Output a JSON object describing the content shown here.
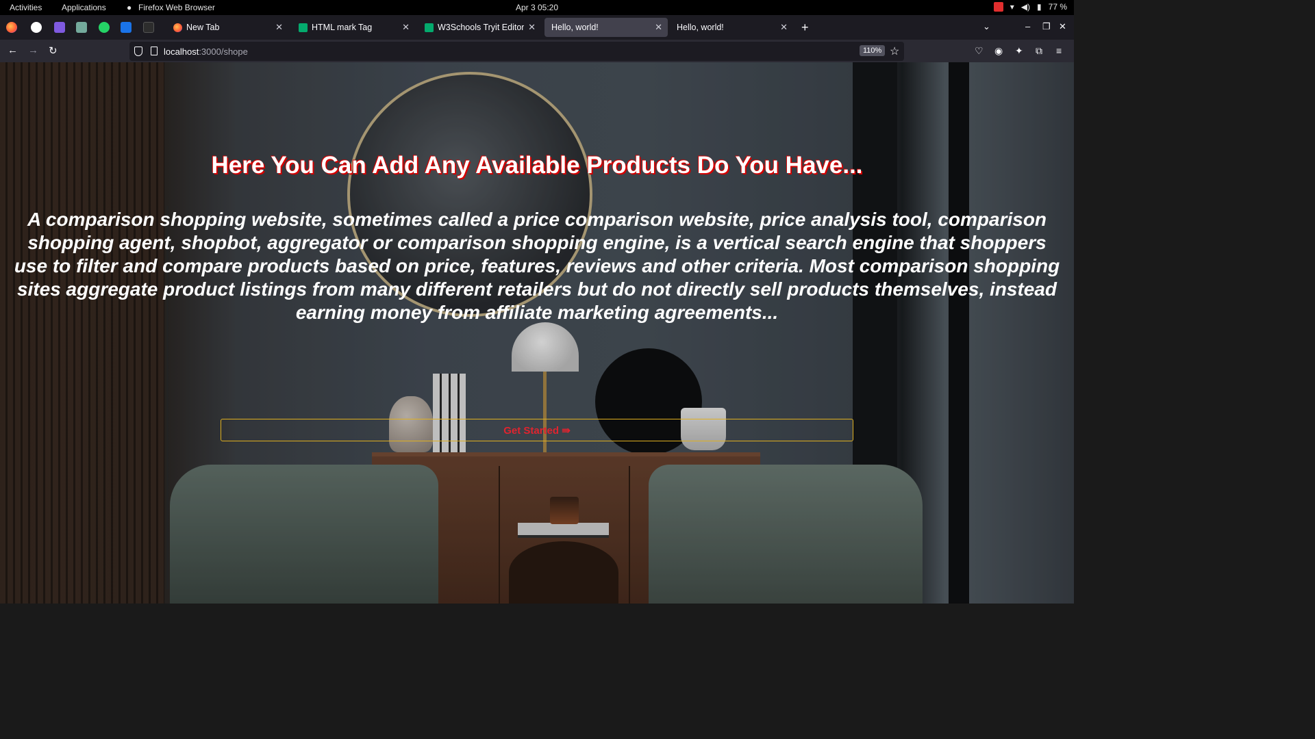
{
  "system_bar": {
    "activities": "Activities",
    "applications": "Applications",
    "app_name": "Firefox Web Browser",
    "clock": "Apr 3  05:20",
    "battery": "77 %"
  },
  "tabs": [
    {
      "label": "New Tab",
      "icon": "firefox-icon",
      "active": false
    },
    {
      "label": "HTML mark Tag",
      "icon": "w3schools-icon",
      "active": false
    },
    {
      "label": "W3Schools Tryit Editor",
      "icon": "w3schools-icon",
      "active": false
    },
    {
      "label": "Hello, world!",
      "icon": "none",
      "active": true
    },
    {
      "label": "Hello, world!",
      "icon": "none",
      "active": false
    }
  ],
  "pinned_tabs": [
    "firefox",
    "github",
    "bootstrap",
    "chatgpt",
    "whatsapp",
    "google-classroom",
    "extension"
  ],
  "address_bar": {
    "host": "localhost",
    "path": ":3000/shope",
    "zoom": "110%"
  },
  "page": {
    "title": "Here You Can Add Any Available Products Do You Have...",
    "description": "A comparison shopping website, sometimes called a price comparison website, price analysis tool, comparison shopping agent, shopbot, aggregator or comparison shopping engine, is a vertical search engine that shoppers use to filter and compare products based on price, features, reviews and other criteria. Most comparison shopping sites aggregate product listings from many different retailers but do not directly sell products themselves, instead earning money from affiliate marketing agreements...",
    "cta": "Get Started ⇛"
  },
  "colors": {
    "title_shadow": "#d40000",
    "cta_text": "#e0242f",
    "cta_border": "#e0b020",
    "toolbar_bg": "#2b2a33",
    "tabstrip_bg": "#1c1b22"
  }
}
